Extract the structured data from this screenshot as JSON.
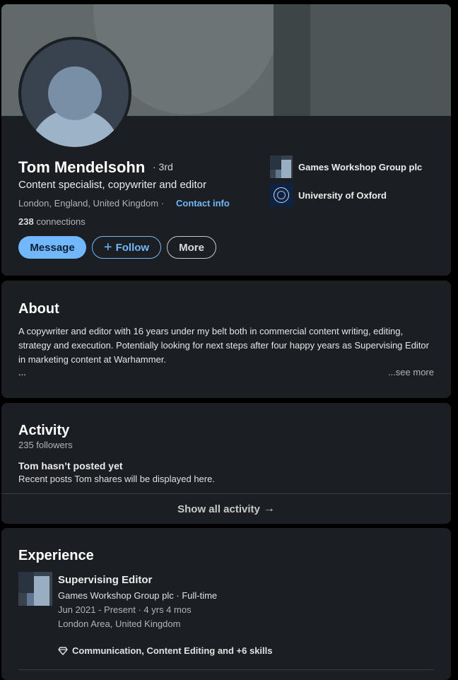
{
  "profile": {
    "name": "Tom Mendelsohn",
    "degree": "· 3rd",
    "headline": "Content specialist, copywriter and editor",
    "location": "London, England, United Kingdom ·",
    "contact_info": "Contact info",
    "connections_count": "238",
    "connections_label": " connections",
    "avatar_icon": "default-person-avatar"
  },
  "actions": {
    "message": "Message",
    "follow": "Follow",
    "follow_icon": "+",
    "more": "More"
  },
  "organizations": [
    {
      "name": "Games Workshop Group plc",
      "icon": "company-logo-placeholder"
    },
    {
      "name": "University of Oxford",
      "icon": "oxford-crest"
    }
  ],
  "about": {
    "title": "About",
    "text": "A copywriter and editor with 16 years under my belt both in commercial content writing, editing, strategy and execution. Potentially looking for next steps after four happy years as Supervising Editor in marketing content at Warhammer.",
    "ellipsis": "...",
    "see_more": "...see more"
  },
  "activity": {
    "title": "Activity",
    "followers": "235 followers",
    "empty_title": "Tom hasn’t posted yet",
    "empty_subtitle": "Recent posts Tom shares will be displayed here.",
    "show_all": "Show all activity",
    "show_all_arrow": "→"
  },
  "experience": {
    "title": "Experience",
    "items": [
      {
        "role": "Supervising Editor",
        "company": "Games Workshop Group plc · Full-time",
        "dates": "Jun 2021 - Present · 4 yrs 4 mos",
        "location": "London Area, United Kingdom",
        "skills": "Communication, Content Editing and +6 skills"
      }
    ]
  },
  "colors": {
    "page_bg": "#000000",
    "card_bg": "#1b1f23",
    "accent": "#71b7fb",
    "text_primary": "#ffffff",
    "text_secondary": "#b3b3b3"
  }
}
